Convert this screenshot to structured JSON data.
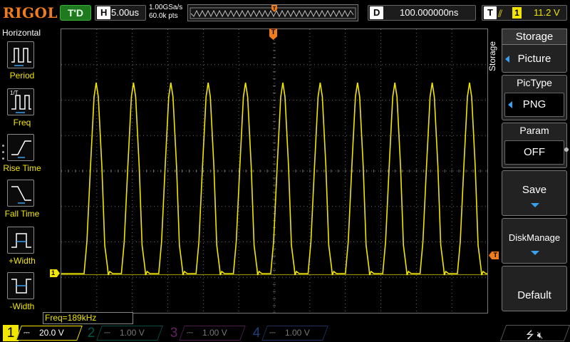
{
  "brand": "RIGOL",
  "run_state": "T'D",
  "timebase": {
    "key": "H",
    "value": "5.00us"
  },
  "acquisition": {
    "sample_rate": "1.00GSa/s",
    "memory_depth": "60.0k pts"
  },
  "delay": {
    "key": "D",
    "value": "100.000000ns"
  },
  "trigger": {
    "key": "T",
    "edge_icon": "rising-edge-icon",
    "source": "1",
    "level": "11.2 V",
    "position_marker": "T",
    "level_marker": "T"
  },
  "left_panel": {
    "title": "Horizontal",
    "items": [
      {
        "label": "Period",
        "icon": "period-icon"
      },
      {
        "label": "Freq",
        "icon": "freq-icon"
      },
      {
        "label": "Rise Time",
        "icon": "rise-time-icon"
      },
      {
        "label": "Fall Time",
        "icon": "fall-time-icon"
      },
      {
        "label": "+Width",
        "icon": "plus-width-icon"
      },
      {
        "label": "-Width",
        "icon": "minus-width-icon"
      }
    ]
  },
  "measurement_result": "Freq=189kHz",
  "menu": {
    "vertical_title": "Storage",
    "title": "Storage",
    "items": [
      {
        "label": "Picture"
      },
      {
        "label": "PicType",
        "value": "PNG"
      },
      {
        "label": "Param",
        "value": "OFF"
      },
      {
        "label": "Save"
      },
      {
        "label": "DiskManage"
      },
      {
        "label": "Default"
      }
    ]
  },
  "channels": [
    {
      "num": "1",
      "coupling": "⎓",
      "scale": "20.0 V",
      "active": true,
      "color": "#f2e600"
    },
    {
      "num": "2",
      "coupling": "⎓",
      "scale": "1.00 V",
      "active": false,
      "color": "#00c0a0"
    },
    {
      "num": "3",
      "coupling": "⎓",
      "scale": "1.00 V",
      "active": false,
      "color": "#e040e0"
    },
    {
      "num": "4",
      "coupling": "⎓",
      "scale": "1.00 V",
      "active": false,
      "color": "#3a7cf0"
    }
  ],
  "ch1_marker": "1",
  "status_icons": [
    "usb-icon",
    "speaker-mute-icon"
  ],
  "colors": {
    "trace": "#f2e600",
    "accent": "#f07c1c",
    "grid": "#6b6b6b",
    "menu_arrow": "#3aa0f0"
  },
  "waveform": {
    "pulse_count": 11,
    "frequency": "189kHz"
  }
}
